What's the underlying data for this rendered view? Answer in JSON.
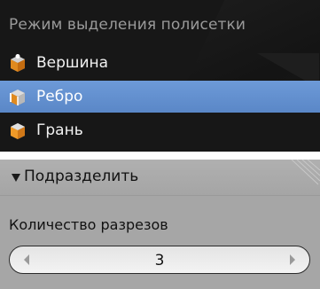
{
  "menu": {
    "title": "Режим выделения полисетки",
    "items": [
      {
        "label": "Вершина",
        "icon": "vertex-cube-icon",
        "active": false
      },
      {
        "label": "Ребро",
        "icon": "edge-cube-icon",
        "active": true
      },
      {
        "label": "Грань",
        "icon": "face-cube-icon",
        "active": false
      }
    ]
  },
  "panel": {
    "title": "Подразделить",
    "expanded": true,
    "field_label": "Количество разрезов",
    "cuts_value": "3"
  },
  "colors": {
    "menu_bg": "#171717",
    "highlight": "#5e8cca",
    "panel_bg": "#a6a6a6",
    "cube_orange": "#e08a1e"
  }
}
